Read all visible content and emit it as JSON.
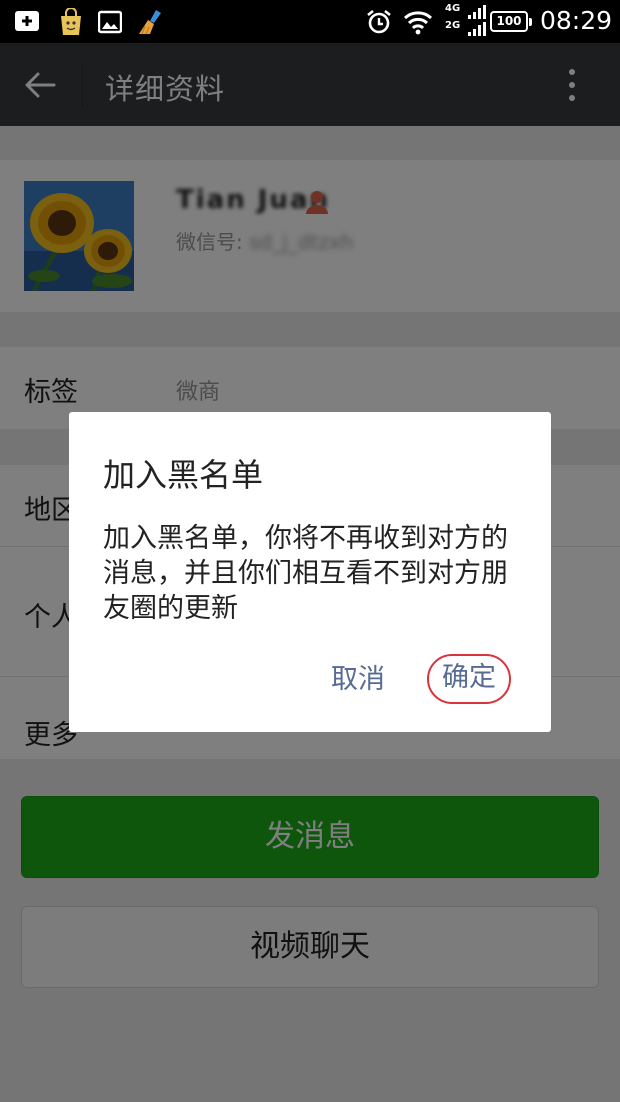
{
  "status_bar": {
    "network_top": "4G",
    "network_bottom": "2G",
    "battery": "100",
    "time": "08:29"
  },
  "header": {
    "title": "详细资料"
  },
  "profile": {
    "nickname": "Tian Juan",
    "wechat_id_label": "微信号: ",
    "wechat_id_value": "sd_j_dtzxh"
  },
  "rows": [
    {
      "label": "标签",
      "value": "微商"
    },
    {
      "label": "地区",
      "value": ""
    },
    {
      "label": "个人",
      "value": ""
    },
    {
      "label": "更多",
      "value": ""
    }
  ],
  "actions": {
    "send_message": "发消息",
    "video_chat": "视频聊天"
  },
  "dialog": {
    "title": "加入黑名单",
    "message": "加入黑名单，你将不再收到对方的消息，并且你们相互看不到对方朋友圈的更新",
    "cancel": "取消",
    "confirm": "确定"
  },
  "colors": {
    "header_bg": "#393a3f",
    "primary_green": "#1aad19",
    "link_blue": "#576b95",
    "highlight_red": "#d9333b"
  },
  "icons": {
    "back": "arrow-left-icon",
    "more": "more-vertical-icon",
    "gender": "person-icon"
  }
}
